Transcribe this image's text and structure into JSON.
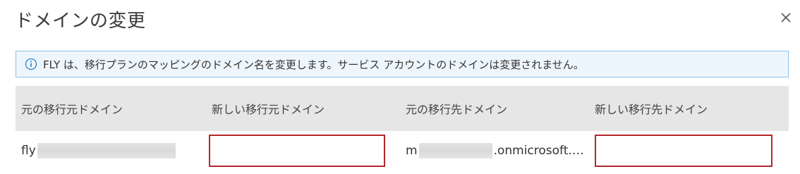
{
  "dialog": {
    "title": "ドメインの変更"
  },
  "info_banner": {
    "text": "FLY は、移行プランのマッピングのドメイン名を変更します。サービス アカウントのドメインは変更されません。"
  },
  "table": {
    "headers": [
      "元の移行元ドメイン",
      "新しい移行元ドメイン",
      "元の移行先ドメイン",
      "新しい移行先ドメイン"
    ],
    "row": {
      "original_source_prefix": "fly",
      "new_source_value": "",
      "original_destination_prefix": "m",
      "original_destination_suffix": ".onmicrosoft.…",
      "new_destination_value": ""
    }
  },
  "colors": {
    "info_bg": "#eef6fd",
    "info_border": "#8fc1e8",
    "info_icon": "#2a7fc4",
    "header_bg": "#e6e6e6",
    "input_error_border": "#b3262b"
  },
  "icons": {
    "close": "close-icon",
    "info": "info-icon"
  }
}
